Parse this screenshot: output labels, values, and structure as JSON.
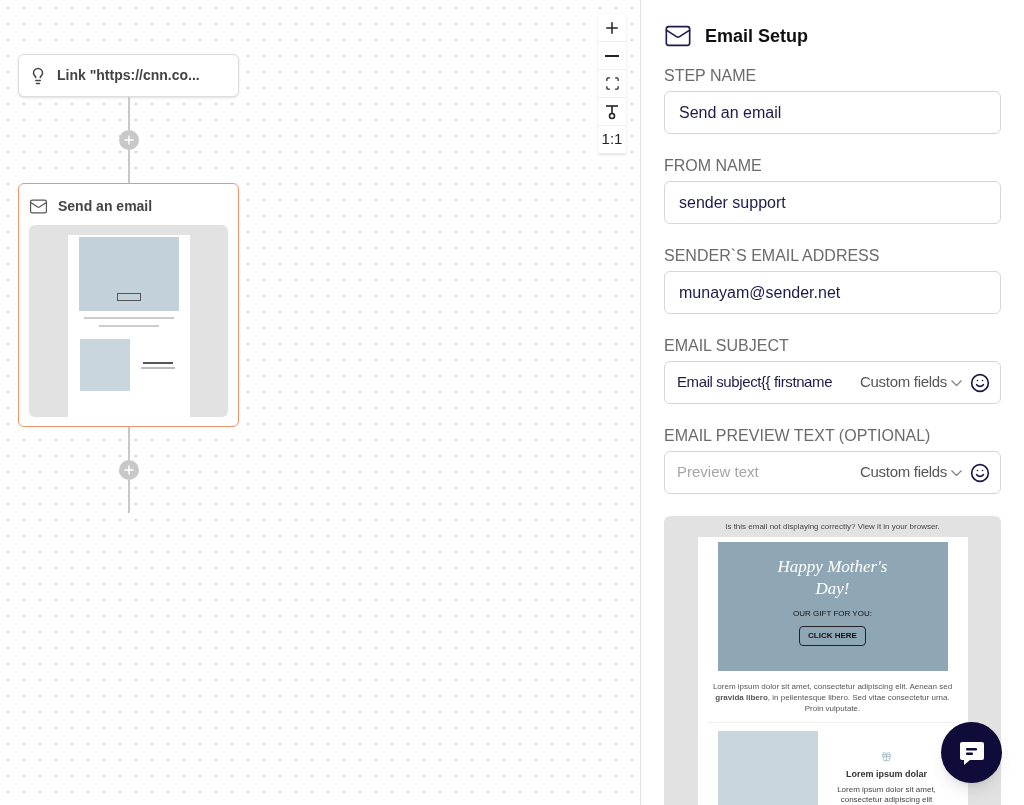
{
  "canvas": {
    "nodes": [
      {
        "kind": "trigger",
        "label": "Link \"https://cnn.co...",
        "selected": false
      },
      {
        "kind": "email",
        "label": "Send an email",
        "selected": true
      }
    ],
    "zoom_controls": [
      {
        "kind": "zoom-in"
      },
      {
        "kind": "zoom-out"
      },
      {
        "kind": "fit"
      },
      {
        "kind": "center"
      },
      {
        "kind": "actual",
        "label": "1:1"
      }
    ]
  },
  "panel": {
    "title": "Email Setup",
    "fields": [
      {
        "kind": "text",
        "label": "STEP NAME",
        "value": "Send an email"
      },
      {
        "kind": "text",
        "label": "FROM NAME",
        "value": "sender support"
      },
      {
        "kind": "text",
        "label": "SENDER`S EMAIL ADDRESS",
        "value": "munayam@sender.net"
      },
      {
        "kind": "personalized",
        "label": "EMAIL SUBJECT",
        "value": "Email subject{{ firstname",
        "dropdown": "Custom fields"
      },
      {
        "kind": "personalized",
        "label": "EMAIL PREVIEW TEXT (OPTIONAL)",
        "placeholder": "Preview text",
        "dropdown": "Custom fields"
      }
    ],
    "preview": {
      "top_note": "Is this email not displaying correctly? View it in your browser.",
      "hero_title": "Happy Mother's Day!",
      "hero_caption": "OUR GIFT FOR YOU:",
      "hero_button": "CLICK HERE",
      "body": "Lorem ipsum dolor sit amet, consectetur adipiscing elit. Aenean sed **gravida libero**, in pellentesque libero. Sed vitae consectetur urna. Proin vulputate.",
      "feature_title": "Lorem ipsum dolar",
      "feature_text": "Lorem ipsum dolor sit amet, consectetur adipiscing elit"
    }
  }
}
